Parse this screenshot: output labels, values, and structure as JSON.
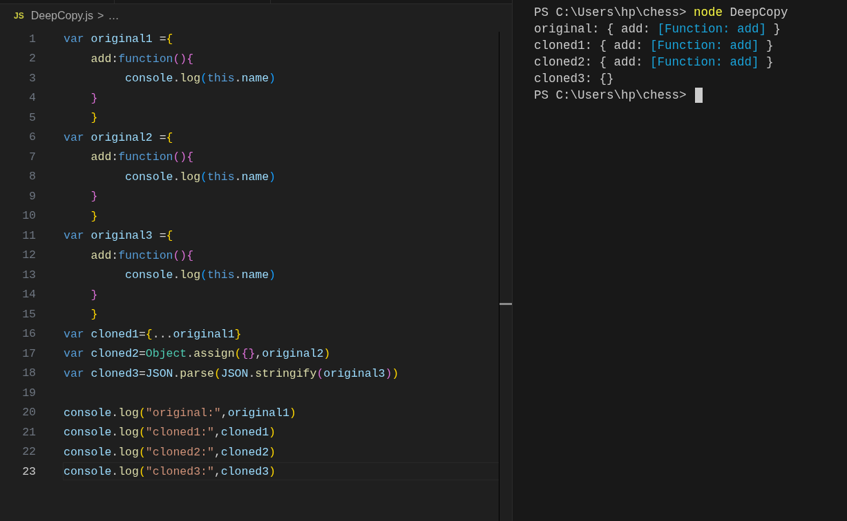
{
  "editor": {
    "breadcrumb": {
      "file_badge": "JS",
      "file": "DeepCopy.js",
      "separator": ">",
      "more": "…"
    },
    "lines": [
      {
        "number": "1",
        "current": false,
        "tokens": [
          {
            "text": "var",
            "kind": "keyword"
          },
          {
            "text": " original1",
            "kind": "variable"
          },
          {
            "text": " =",
            "kind": "punct"
          },
          {
            "text": "{",
            "kind": "bracket1"
          }
        ]
      },
      {
        "number": "2",
        "current": false,
        "tokens": [
          {
            "text": "    add",
            "kind": "function"
          },
          {
            "text": ":",
            "kind": "punct"
          },
          {
            "text": "function",
            "kind": "keyword"
          },
          {
            "text": "()",
            "kind": "bracket2"
          },
          {
            "text": "{",
            "kind": "bracket2"
          }
        ]
      },
      {
        "number": "3",
        "current": false,
        "tokens": [
          {
            "text": "         console",
            "kind": "variable"
          },
          {
            "text": ".",
            "kind": "punct"
          },
          {
            "text": "log",
            "kind": "function"
          },
          {
            "text": "(",
            "kind": "bracket3"
          },
          {
            "text": "this",
            "kind": "keyword"
          },
          {
            "text": ".",
            "kind": "punct"
          },
          {
            "text": "name",
            "kind": "variable"
          },
          {
            "text": ")",
            "kind": "bracket3"
          }
        ]
      },
      {
        "number": "4",
        "current": false,
        "tokens": [
          {
            "text": "    }",
            "kind": "bracket2"
          }
        ]
      },
      {
        "number": "5",
        "current": false,
        "tokens": [
          {
            "text": "    }",
            "kind": "bracket1"
          }
        ]
      },
      {
        "number": "6",
        "current": false,
        "tokens": [
          {
            "text": "var",
            "kind": "keyword"
          },
          {
            "text": " original2",
            "kind": "variable"
          },
          {
            "text": " =",
            "kind": "punct"
          },
          {
            "text": "{",
            "kind": "bracket1"
          }
        ]
      },
      {
        "number": "7",
        "current": false,
        "tokens": [
          {
            "text": "    add",
            "kind": "function"
          },
          {
            "text": ":",
            "kind": "punct"
          },
          {
            "text": "function",
            "kind": "keyword"
          },
          {
            "text": "()",
            "kind": "bracket2"
          },
          {
            "text": "{",
            "kind": "bracket2"
          }
        ]
      },
      {
        "number": "8",
        "current": false,
        "tokens": [
          {
            "text": "         console",
            "kind": "variable"
          },
          {
            "text": ".",
            "kind": "punct"
          },
          {
            "text": "log",
            "kind": "function"
          },
          {
            "text": "(",
            "kind": "bracket3"
          },
          {
            "text": "this",
            "kind": "keyword"
          },
          {
            "text": ".",
            "kind": "punct"
          },
          {
            "text": "name",
            "kind": "variable"
          },
          {
            "text": ")",
            "kind": "bracket3"
          }
        ]
      },
      {
        "number": "9",
        "current": false,
        "tokens": [
          {
            "text": "    }",
            "kind": "bracket2"
          }
        ]
      },
      {
        "number": "10",
        "current": false,
        "tokens": [
          {
            "text": "    }",
            "kind": "bracket1"
          }
        ]
      },
      {
        "number": "11",
        "current": false,
        "tokens": [
          {
            "text": "var",
            "kind": "keyword"
          },
          {
            "text": " original3",
            "kind": "variable"
          },
          {
            "text": " =",
            "kind": "punct"
          },
          {
            "text": "{",
            "kind": "bracket1"
          }
        ]
      },
      {
        "number": "12",
        "current": false,
        "tokens": [
          {
            "text": "    add",
            "kind": "function"
          },
          {
            "text": ":",
            "kind": "punct"
          },
          {
            "text": "function",
            "kind": "keyword"
          },
          {
            "text": "()",
            "kind": "bracket2"
          },
          {
            "text": "{",
            "kind": "bracket2"
          }
        ]
      },
      {
        "number": "13",
        "current": false,
        "tokens": [
          {
            "text": "         console",
            "kind": "variable"
          },
          {
            "text": ".",
            "kind": "punct"
          },
          {
            "text": "log",
            "kind": "function"
          },
          {
            "text": "(",
            "kind": "bracket3"
          },
          {
            "text": "this",
            "kind": "keyword"
          },
          {
            "text": ".",
            "kind": "punct"
          },
          {
            "text": "name",
            "kind": "variable"
          },
          {
            "text": ")",
            "kind": "bracket3"
          }
        ]
      },
      {
        "number": "14",
        "current": false,
        "tokens": [
          {
            "text": "    }",
            "kind": "bracket2"
          }
        ]
      },
      {
        "number": "15",
        "current": false,
        "tokens": [
          {
            "text": "    }",
            "kind": "bracket1"
          }
        ]
      },
      {
        "number": "16",
        "current": false,
        "tokens": [
          {
            "text": "var",
            "kind": "keyword"
          },
          {
            "text": " cloned1",
            "kind": "variable"
          },
          {
            "text": "=",
            "kind": "punct"
          },
          {
            "text": "{",
            "kind": "bracket1"
          },
          {
            "text": "...",
            "kind": "punct"
          },
          {
            "text": "original1",
            "kind": "variable"
          },
          {
            "text": "}",
            "kind": "bracket1"
          }
        ]
      },
      {
        "number": "17",
        "current": false,
        "tokens": [
          {
            "text": "var",
            "kind": "keyword"
          },
          {
            "text": " cloned2",
            "kind": "variable"
          },
          {
            "text": "=",
            "kind": "punct"
          },
          {
            "text": "Object",
            "kind": "class"
          },
          {
            "text": ".",
            "kind": "punct"
          },
          {
            "text": "assign",
            "kind": "function"
          },
          {
            "text": "(",
            "kind": "bracket1"
          },
          {
            "text": "{}",
            "kind": "bracket2"
          },
          {
            "text": ",",
            "kind": "punct"
          },
          {
            "text": "original2",
            "kind": "variable"
          },
          {
            "text": ")",
            "kind": "bracket1"
          }
        ]
      },
      {
        "number": "18",
        "current": false,
        "tokens": [
          {
            "text": "var",
            "kind": "keyword"
          },
          {
            "text": " cloned3",
            "kind": "variable"
          },
          {
            "text": "=",
            "kind": "punct"
          },
          {
            "text": "JSON",
            "kind": "variable"
          },
          {
            "text": ".",
            "kind": "punct"
          },
          {
            "text": "parse",
            "kind": "function"
          },
          {
            "text": "(",
            "kind": "bracket1"
          },
          {
            "text": "JSON",
            "kind": "variable"
          },
          {
            "text": ".",
            "kind": "punct"
          },
          {
            "text": "stringify",
            "kind": "function"
          },
          {
            "text": "(",
            "kind": "bracket2"
          },
          {
            "text": "original3",
            "kind": "variable"
          },
          {
            "text": ")",
            "kind": "bracket2"
          },
          {
            "text": ")",
            "kind": "bracket1"
          }
        ]
      },
      {
        "number": "19",
        "current": false
      },
      {
        "number": "20",
        "current": false,
        "tokens": [
          {
            "text": "console",
            "kind": "variable"
          },
          {
            "text": ".",
            "kind": "punct"
          },
          {
            "text": "log",
            "kind": "function"
          },
          {
            "text": "(",
            "kind": "bracket1"
          },
          {
            "text": "\"original:\"",
            "kind": "string"
          },
          {
            "text": ",",
            "kind": "punct"
          },
          {
            "text": "original1",
            "kind": "variable"
          },
          {
            "text": ")",
            "kind": "bracket1"
          }
        ]
      },
      {
        "number": "21",
        "current": false,
        "tokens": [
          {
            "text": "console",
            "kind": "variable"
          },
          {
            "text": ".",
            "kind": "punct"
          },
          {
            "text": "log",
            "kind": "function"
          },
          {
            "text": "(",
            "kind": "bracket1"
          },
          {
            "text": "\"cloned1:\"",
            "kind": "string"
          },
          {
            "text": ",",
            "kind": "punct"
          },
          {
            "text": "cloned1",
            "kind": "variable"
          },
          {
            "text": ")",
            "kind": "bracket1"
          }
        ]
      },
      {
        "number": "22",
        "current": false,
        "tokens": [
          {
            "text": "console",
            "kind": "variable"
          },
          {
            "text": ".",
            "kind": "punct"
          },
          {
            "text": "log",
            "kind": "function"
          },
          {
            "text": "(",
            "kind": "bracket1"
          },
          {
            "text": "\"cloned2:\"",
            "kind": "string"
          },
          {
            "text": ",",
            "kind": "punct"
          },
          {
            "text": "cloned2",
            "kind": "variable"
          },
          {
            "text": ")",
            "kind": "bracket1"
          }
        ]
      },
      {
        "number": "23",
        "current": true,
        "tokens": [
          {
            "text": "console",
            "kind": "variable"
          },
          {
            "text": ".",
            "kind": "punct"
          },
          {
            "text": "log",
            "kind": "function"
          },
          {
            "text": "(",
            "kind": "bracket1"
          },
          {
            "text": "\"cloned3:\"",
            "kind": "string"
          },
          {
            "text": ",",
            "kind": "punct"
          },
          {
            "text": "cloned3",
            "kind": "variable"
          },
          {
            "text": ")",
            "kind": "bracket1"
          }
        ]
      }
    ]
  },
  "terminal": {
    "cursor_visible": true,
    "lines": [
      {
        "tokens": [
          {
            "text": "PS C:\\Users\\hp\\chess> ",
            "kind": "plain"
          },
          {
            "text": "node",
            "kind": "command"
          },
          {
            "text": " DeepCopy",
            "kind": "plain"
          }
        ]
      },
      {
        "tokens": [
          {
            "text": "original: { add: ",
            "kind": "plain"
          },
          {
            "text": "[Function: add]",
            "kind": "ref"
          },
          {
            "text": " }",
            "kind": "plain"
          }
        ]
      },
      {
        "tokens": [
          {
            "text": "cloned1: { add: ",
            "kind": "plain"
          },
          {
            "text": "[Function: add]",
            "kind": "ref"
          },
          {
            "text": " }",
            "kind": "plain"
          }
        ]
      },
      {
        "tokens": [
          {
            "text": "cloned2: { add: ",
            "kind": "plain"
          },
          {
            "text": "[Function: add]",
            "kind": "ref"
          },
          {
            "text": " }",
            "kind": "plain"
          }
        ]
      },
      {
        "tokens": [
          {
            "text": "cloned3: {}",
            "kind": "plain"
          }
        ]
      },
      {
        "tokens": [
          {
            "text": "PS C:\\Users\\hp\\chess> ",
            "kind": "plain"
          }
        ]
      }
    ]
  }
}
